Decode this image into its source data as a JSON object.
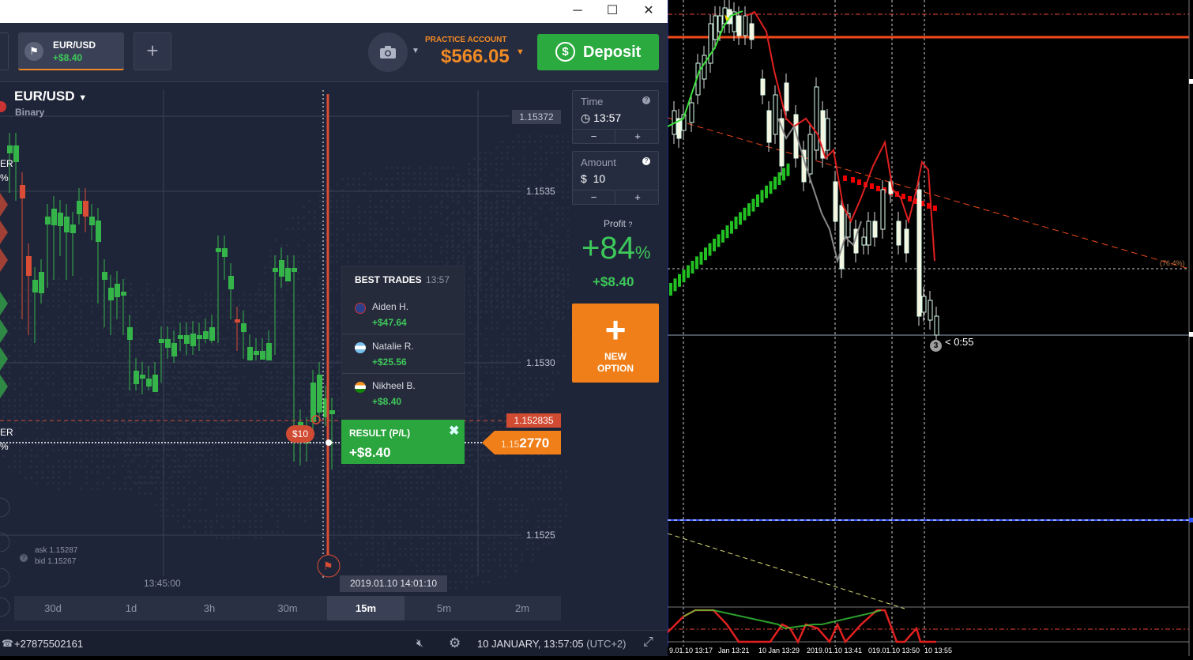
{
  "window": {
    "minimize": "─",
    "maximize": "☐",
    "close": "✕"
  },
  "topbar": {
    "asset_tab": {
      "name": "EUR/USD",
      "profit": "+$8.40"
    },
    "add_tab": "+",
    "account": {
      "label": "PRACTICE ACCOUNT",
      "balance": "$566.05"
    },
    "deposit": {
      "label": "Deposit",
      "icon": "dollar-refresh-icon"
    }
  },
  "chart": {
    "pair": "EUR/USD",
    "pair_type": "Binary",
    "price_levels": [
      "1.15372",
      "1.1535",
      "1.1530",
      "1.1525"
    ],
    "entry_price": "1.152835",
    "current_price_prefix": "1.15",
    "current_price_main": "2770",
    "bet_badge": "$10",
    "ask": "ask 1.15287",
    "bid": "bid 1.15267",
    "side_labels": [
      "ER",
      "%",
      "ER",
      "%"
    ],
    "x_time": "13:45:00",
    "x_date": "2019.01.10 14:01:10",
    "colors": {
      "bull": "#35b44a",
      "bear": "#d94c35",
      "bg": "#1f2538"
    }
  },
  "best_trades": {
    "title": "BEST TRADES",
    "time": "13:57",
    "rows": [
      {
        "name": "Aiden H.",
        "amount": "+$47.64",
        "flag": "uk-flag-icon"
      },
      {
        "name": "Natalie R.",
        "amount": "+$25.56",
        "flag": "argentina-flag-icon"
      },
      {
        "name": "Nikheel B.",
        "amount": "+$8.40",
        "flag": "india-flag-icon"
      }
    ]
  },
  "result": {
    "title": "RESULT (P/L)",
    "value": "+$8.40",
    "close": "✖"
  },
  "timeframes": [
    {
      "label": "30d",
      "active": false
    },
    {
      "label": "1d",
      "active": false
    },
    {
      "label": "3h",
      "active": false
    },
    {
      "label": "30m",
      "active": false
    },
    {
      "label": "15m",
      "active": true
    },
    {
      "label": "5m",
      "active": false
    },
    {
      "label": "2m",
      "active": false
    }
  ],
  "panel": {
    "time": {
      "label": "Time",
      "value": "13:57",
      "minus": "−",
      "plus": "+"
    },
    "amount": {
      "label": "Amount",
      "currency": "$",
      "value": "10",
      "minus": "−",
      "plus": "+"
    },
    "profit": {
      "label": "Profit",
      "percent": "+84",
      "percent_sign": "%",
      "amount": "+$8.40"
    },
    "new_option": {
      "line1": "NEW",
      "line2": "OPTION",
      "plus": "+"
    }
  },
  "statusbar": {
    "phone": "+27875502161",
    "date": "10 JANUARY, 13:57:05",
    "tz": "(UTC+2)"
  },
  "mt": {
    "timer_num": "3",
    "timer_text": "< 0:55",
    "fib_label": "(76.4%)",
    "x_labels": [
      "9.01.10 13:17",
      "Jan 13:21",
      "10 Jan 13:29",
      "2019.01.10 13:41",
      "019.01.10 13:50",
      "10 13:55"
    ]
  }
}
